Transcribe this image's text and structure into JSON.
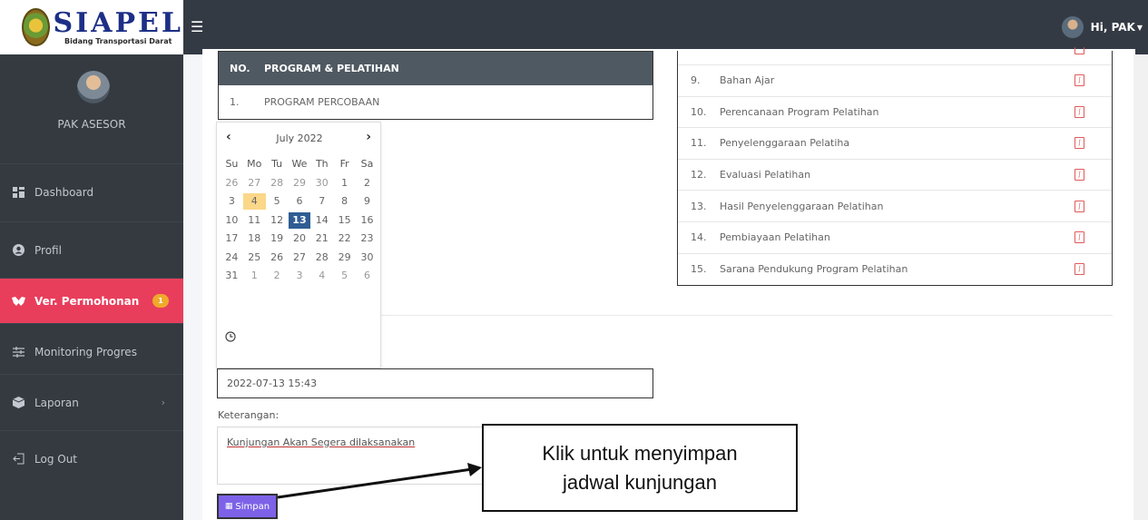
{
  "header": {
    "logo_title": "SIAPEL",
    "logo_subtitle": "Bidang Transportasi Darat",
    "menu_icon": "hamburger-icon",
    "user_greeting": "Hi, PAK"
  },
  "sidebar": {
    "profile_name": "PAK ASESOR",
    "items": [
      {
        "label": "Dashboard",
        "icon": "dashboard-icon"
      },
      {
        "label": "Profil",
        "icon": "user-icon"
      },
      {
        "label": "Ver. Permohonan",
        "icon": "handshake-icon",
        "badge": "1",
        "active": true
      },
      {
        "label": "Monitoring Progres",
        "icon": "sliders-icon"
      },
      {
        "label": "Laporan",
        "icon": "box-icon",
        "chevron": "›"
      },
      {
        "label": "Log Out",
        "icon": "logout-icon"
      }
    ]
  },
  "program_table": {
    "headers": [
      "NO.",
      "PROGRAM & PELATIHAN"
    ],
    "rows": [
      [
        "1.",
        "PROGRAM PERCOBAAN"
      ]
    ]
  },
  "document_table": {
    "rows": [
      {
        "no": "9.",
        "name": "Bahan Ajar"
      },
      {
        "no": "10.",
        "name": "Perencanaan Program Pelatihan"
      },
      {
        "no": "11.",
        "name": "Penyelenggaraan Pelatiha"
      },
      {
        "no": "12.",
        "name": "Evaluasi Pelatihan"
      },
      {
        "no": "13.",
        "name": "Hasil Penyelenggaraan Pelatihan"
      },
      {
        "no": "14.",
        "name": "Pembiayaan Pelatihan"
      },
      {
        "no": "15.",
        "name": "Sarana Pendukung Program Pelatihan"
      }
    ]
  },
  "datepicker": {
    "prev": "‹",
    "next": "›",
    "month_label": "July 2022",
    "weekdays": [
      "Su",
      "Mo",
      "Tu",
      "We",
      "Th",
      "Fr",
      "Sa"
    ],
    "weeks": [
      [
        "26",
        "27",
        "28",
        "29",
        "30",
        "1",
        "2"
      ],
      [
        "3",
        "4",
        "5",
        "6",
        "7",
        "8",
        "9"
      ],
      [
        "10",
        "11",
        "12",
        "13",
        "14",
        "15",
        "16"
      ],
      [
        "17",
        "18",
        "19",
        "20",
        "21",
        "22",
        "23"
      ],
      [
        "24",
        "25",
        "26",
        "27",
        "28",
        "29",
        "30"
      ],
      [
        "31",
        "1",
        "2",
        "3",
        "4",
        "5",
        "6"
      ]
    ],
    "today": "4",
    "selected": "13",
    "clock_icon": "clock-icon"
  },
  "form": {
    "datetime_value": "2022-07-13 15:43",
    "keterangan_label": "Keterangan:",
    "keterangan_value": "Kunjungan Akan Segera dilaksanakan",
    "save_label": "Simpan"
  },
  "annotation": {
    "line1": "Klik untuk menyimpan",
    "line2": "jadwal kunjungan"
  },
  "colors": {
    "sidebar_bg": "#343a40",
    "active_nav": "#e83e5c",
    "save_button": "#7d62e8",
    "selected_date": "#2f5d93",
    "today_date": "#fbd78a",
    "badge": "#f0a92a"
  }
}
